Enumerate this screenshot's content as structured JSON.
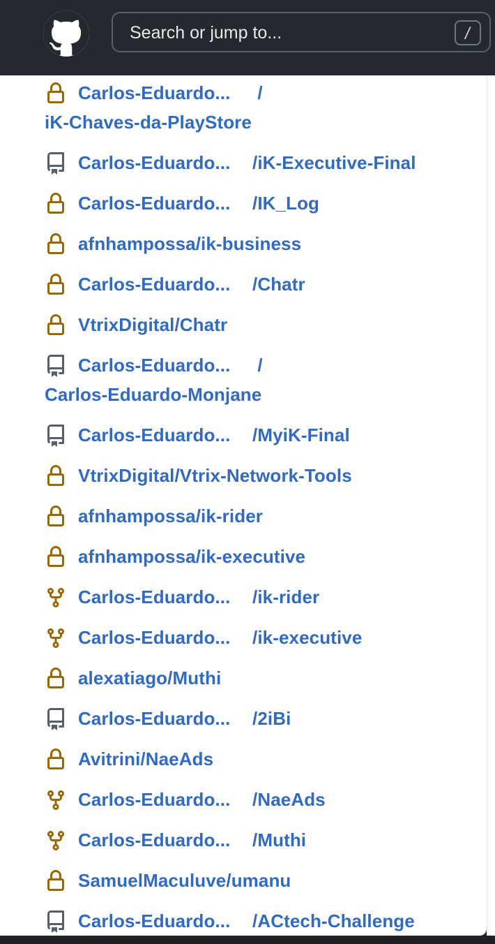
{
  "header": {
    "search_placeholder": "Search or jump to...",
    "shortcut_key": "/"
  },
  "repos": [
    {
      "icon": "lock-icon",
      "owner": "Carlos-Eduardo...",
      "sep": " /",
      "name": "",
      "line2": "iK-Chaves-da-PlayStore"
    },
    {
      "icon": "repo-icon",
      "owner": "Carlos-Eduardo...",
      "sep": " ",
      "name": "/iK-Executive-Final",
      "line2": ""
    },
    {
      "icon": "lock-icon",
      "owner": "Carlos-Eduardo...",
      "sep": " ",
      "name": "/IK_Log",
      "line2": ""
    },
    {
      "icon": "lock-icon",
      "owner": "afnhampossa/ik-business",
      "sep": "",
      "name": "",
      "line2": ""
    },
    {
      "icon": "lock-icon",
      "owner": "Carlos-Eduardo...",
      "sep": " ",
      "name": "/Chatr",
      "line2": ""
    },
    {
      "icon": "lock-icon",
      "owner": "VtrixDigital/Chatr",
      "sep": "",
      "name": "",
      "line2": ""
    },
    {
      "icon": "repo-icon",
      "owner": "Carlos-Eduardo...",
      "sep": " /",
      "name": "",
      "line2": "Carlos-Eduardo-Monjane"
    },
    {
      "icon": "repo-icon",
      "owner": "Carlos-Eduardo...",
      "sep": " ",
      "name": "/MyiK-Final",
      "line2": ""
    },
    {
      "icon": "lock-icon",
      "owner": "VtrixDigital/Vtrix-Network-Tools",
      "sep": "",
      "name": "",
      "line2": ""
    },
    {
      "icon": "lock-icon",
      "owner": "afnhampossa/ik-rider",
      "sep": "",
      "name": "",
      "line2": ""
    },
    {
      "icon": "lock-icon",
      "owner": "afnhampossa/ik-executive",
      "sep": "",
      "name": "",
      "line2": ""
    },
    {
      "icon": "fork-icon",
      "owner": "Carlos-Eduardo...",
      "sep": " ",
      "name": "/ik-rider",
      "line2": ""
    },
    {
      "icon": "fork-icon",
      "owner": "Carlos-Eduardo...",
      "sep": " ",
      "name": "/ik-executive",
      "line2": ""
    },
    {
      "icon": "lock-icon",
      "owner": "alexatiago/Muthi",
      "sep": "",
      "name": "",
      "line2": ""
    },
    {
      "icon": "repo-icon",
      "owner": "Carlos-Eduardo...",
      "sep": " ",
      "name": "/2iBi",
      "line2": ""
    },
    {
      "icon": "lock-icon",
      "owner": "Avitrini/NaeAds",
      "sep": "",
      "name": "",
      "line2": ""
    },
    {
      "icon": "fork-icon",
      "owner": "Carlos-Eduardo...",
      "sep": " ",
      "name": "/NaeAds",
      "line2": ""
    },
    {
      "icon": "fork-icon",
      "owner": "Carlos-Eduardo...",
      "sep": " ",
      "name": "/Muthi",
      "line2": ""
    },
    {
      "icon": "lock-icon",
      "owner": "SamuelMaculuve/umanu",
      "sep": "",
      "name": "",
      "line2": ""
    },
    {
      "icon": "repo-icon",
      "owner": "Carlos-Eduardo...",
      "sep": " ",
      "name": "/ACtech-Challenge",
      "line2": ""
    }
  ],
  "colors": {
    "header_bg": "#24292f",
    "link": "#2f6ac8",
    "lock_icon": "#9a6700",
    "repo_icon": "#57606a"
  }
}
